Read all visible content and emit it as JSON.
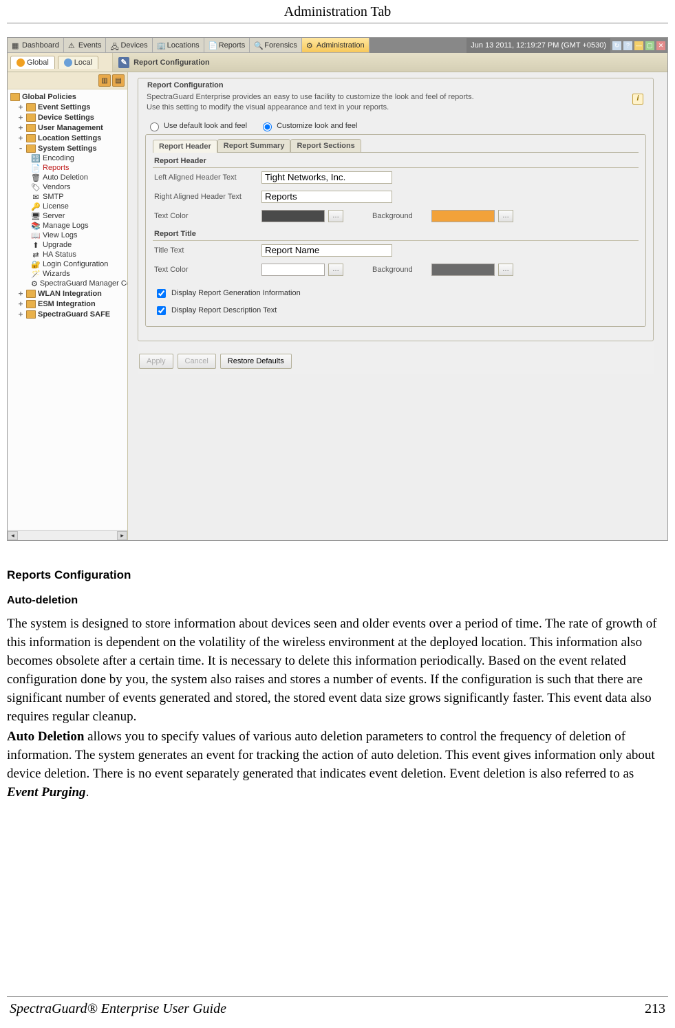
{
  "page": {
    "header": "Administration Tab",
    "footer_title": "SpectraGuard® Enterprise User Guide",
    "page_number": "213"
  },
  "app": {
    "tabs": [
      "Dashboard",
      "Events",
      "Devices",
      "Locations",
      "Reports",
      "Forensics",
      "Administration"
    ],
    "active_tab": 6,
    "datetime": "Jun 13 2011, 12:19:27 PM (GMT +0530)",
    "scope_tabs": [
      "Global",
      "Local"
    ],
    "active_scope": 0,
    "content_title": "Report Configuration"
  },
  "tree": {
    "root": "Global Policies",
    "branches": [
      {
        "label": "Event Settings",
        "expandable": true
      },
      {
        "label": "Device Settings",
        "expandable": true
      },
      {
        "label": "User Management",
        "expandable": true
      },
      {
        "label": "Location Settings",
        "expandable": true
      }
    ],
    "system": {
      "label": "System Settings",
      "children": [
        "Encoding",
        "Reports",
        "Auto Deletion",
        "Vendors",
        "SMTP",
        "License",
        "Server",
        "Manage Logs",
        "View Logs",
        "Upgrade",
        "HA Status",
        "Login Configuration",
        "Wizards",
        "SpectraGuard Manager Configu"
      ],
      "selected_index": 1
    },
    "tail": [
      {
        "label": "WLAN Integration",
        "expandable": true
      },
      {
        "label": "ESM Integration",
        "expandable": true
      },
      {
        "label": "SpectraGuard SAFE",
        "expandable": true
      }
    ]
  },
  "config": {
    "fieldset_title": "Report Configuration",
    "help1": "SpectraGuard Enterprise provides an easy to use facility to customize the look and feel of reports.",
    "help2": "Use this setting to modify the visual appearance and text in your reports.",
    "radio_default": "Use default look and feel",
    "radio_custom": "Customize look and feel",
    "radio_selected": "custom",
    "subtabs": [
      "Report Header",
      "Report Summary",
      "Report Sections"
    ],
    "active_subtab": 0,
    "header_section": "Report Header",
    "left_header_label": "Left Aligned Header Text",
    "left_header_value": "Tight Networks, Inc.",
    "right_header_label": "Right Aligned Header Text",
    "right_header_value": "Reports",
    "text_color_label": "Text Color",
    "header_text_color": "#4a4a4a",
    "background_label": "Background",
    "header_bg_color": "#f2a23a",
    "title_section": "Report Title",
    "title_text_label": "Title Text",
    "title_text_value": "Report Name",
    "title_text_color": "#ffffff",
    "title_bg_color": "#6b6b6b",
    "chk1": "Display Report Generation Information",
    "chk2": "Display Report Description Text",
    "chk1_checked": true,
    "chk2_checked": true,
    "btn_apply": "Apply",
    "btn_cancel": "Cancel",
    "btn_restore": "Restore Defaults"
  },
  "body": {
    "h3": "Reports Configuration",
    "h4": "Auto-deletion",
    "p1": "The system is designed to store information about devices seen and older events over a period of time. The rate of growth of this information is dependent on the volatility of the wireless environment at the deployed location. This information also becomes obsolete after a certain time. It is necessary to delete this information periodically. Based on the event related configuration done by you, the system also raises and stores a number of events. If the configuration is such that there are significant number of events generated and stored, the stored event data size grows significantly faster. This event data also requires regular cleanup.",
    "p2a": "Auto Deletion",
    "p2b": " allows you to specify values of various auto deletion parameters to control the frequency of deletion of information. The system generates an event for tracking the action of auto deletion. This event gives information only about device deletion. There is no event separately generated that indicates event deletion. Event deletion is also referred to as ",
    "p2c": "Event Purging",
    "p2d": "."
  }
}
